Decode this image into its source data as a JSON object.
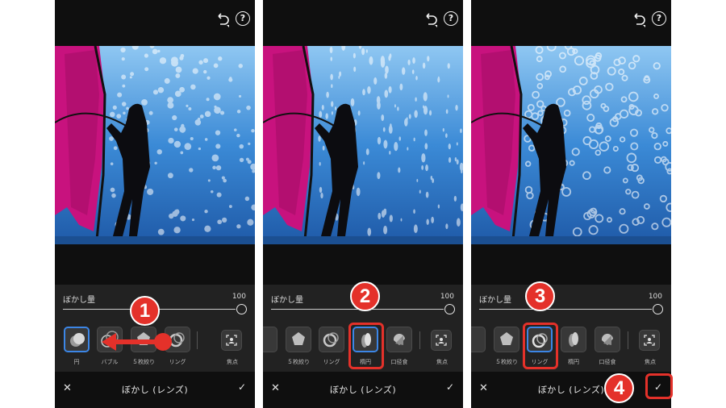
{
  "panels": [
    {
      "blur_label": "ぼかし量",
      "blur_value": "100",
      "shapes": [
        {
          "label": "円",
          "icon": "circle-bokeh-icon",
          "selected": true
        },
        {
          "label": "バブル",
          "icon": "bubble-bokeh-icon",
          "selected": false
        },
        {
          "label": "５枚絞り",
          "icon": "five-blade-bokeh-icon",
          "selected": false
        },
        {
          "label": "リング",
          "icon": "ring-bokeh-icon",
          "selected": false
        }
      ],
      "focus_label": "焦点",
      "title": "ぼかし (レンズ)",
      "cancel": "✕",
      "confirm": "✓"
    },
    {
      "blur_label": "ぼかし量",
      "blur_value": "100",
      "shapes": [
        {
          "label": "５枚絞り",
          "icon": "five-blade-bokeh-icon",
          "selected": false
        },
        {
          "label": "リング",
          "icon": "ring-bokeh-icon",
          "selected": false
        },
        {
          "label": "楕円",
          "icon": "ellipse-bokeh-icon",
          "selected": true
        },
        {
          "label": "口径食",
          "icon": "cat-eye-bokeh-icon",
          "selected": false
        }
      ],
      "focus_label": "焦点",
      "title": "ぼかし (レンズ)",
      "cancel": "✕",
      "confirm": "✓"
    },
    {
      "blur_label": "ぼかし量",
      "blur_value": "100",
      "shapes": [
        {
          "label": "５枚絞り",
          "icon": "five-blade-bokeh-icon",
          "selected": false
        },
        {
          "label": "リング",
          "icon": "ring-bokeh-icon",
          "selected": true
        },
        {
          "label": "楕円",
          "icon": "ellipse-bokeh-icon",
          "selected": false
        },
        {
          "label": "口径食",
          "icon": "cat-eye-bokeh-icon",
          "selected": false
        }
      ],
      "focus_label": "焦点",
      "title": "ぼかし (レンズ)",
      "cancel": "✕",
      "confirm": "✓"
    }
  ],
  "steps": [
    "1",
    "2",
    "3",
    "4"
  ],
  "colors": {
    "accent": "#e4312a",
    "selected": "#3c86e6",
    "sail": "#c8127e",
    "water": "#2a6fb5"
  }
}
